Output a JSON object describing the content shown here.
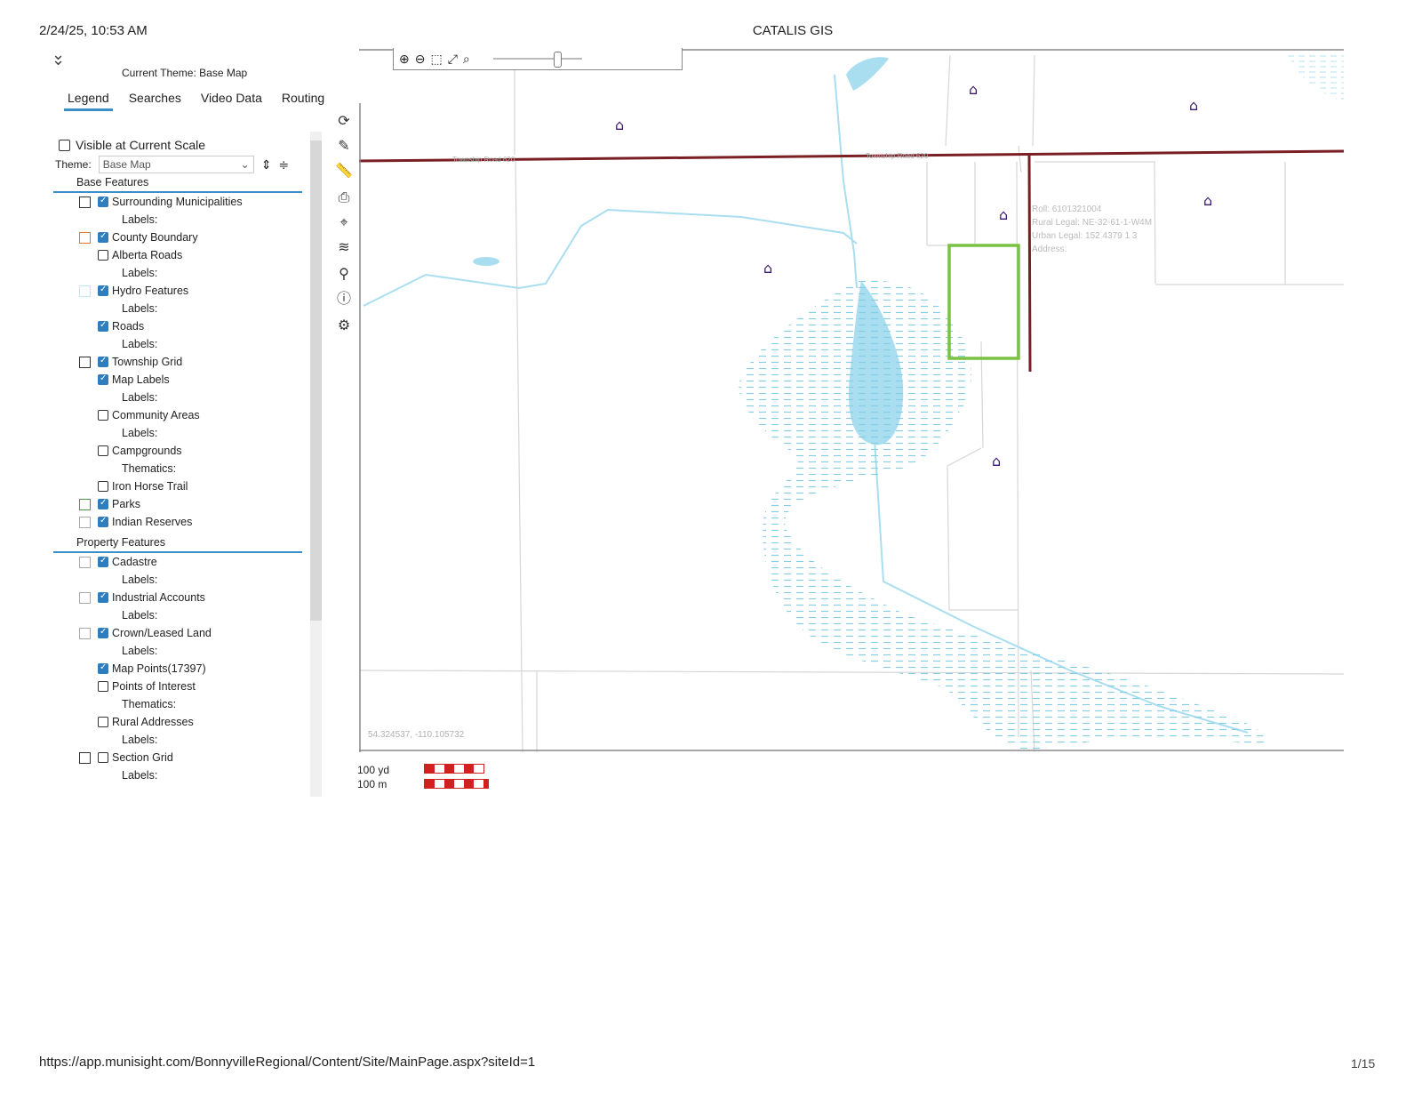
{
  "print_header": {
    "datetime": "2/24/25, 10:53 AM",
    "title": "CATALIS GIS"
  },
  "print_footer": {
    "url": "https://app.munisight.com/BonnyvilleRegional/Content/Site/MainPage.aspx?siteId=1",
    "page": "1/15"
  },
  "panel": {
    "current_theme_label": "Current Theme:",
    "current_theme_value": "Base Map",
    "tabs": [
      {
        "label": "Legend",
        "active": true
      },
      {
        "label": "Searches",
        "active": false
      },
      {
        "label": "Video Data",
        "active": false
      },
      {
        "label": "Routing",
        "active": false
      }
    ],
    "visible_at_scale": "Visible at Current Scale",
    "theme_label": "Theme:",
    "theme_value": "Base Map"
  },
  "legend": {
    "base_header": "Base Features",
    "base": [
      {
        "name": "Surrounding Municipalities",
        "checked": true,
        "swatch": "#333333",
        "sub": "Labels:"
      },
      {
        "name": "County Boundary",
        "checked": true,
        "swatch": "#e07a2e",
        "sub": ""
      },
      {
        "name": "Alberta Roads",
        "checked": false,
        "swatch": "",
        "sub": "Labels:"
      },
      {
        "name": "Hydro Features",
        "checked": true,
        "swatch": "#bfe7f5",
        "sub": "Labels:"
      },
      {
        "name": "Roads",
        "checked": true,
        "swatch": "",
        "sub": "Labels:"
      },
      {
        "name": "Township Grid",
        "checked": true,
        "swatch": "#333333",
        "sub": ""
      },
      {
        "name": "Map Labels",
        "checked": true,
        "swatch": "",
        "sub": "Labels:"
      },
      {
        "name": "Community Areas",
        "checked": false,
        "swatch": "",
        "sub": "Labels:"
      },
      {
        "name": "Campgrounds",
        "checked": false,
        "swatch": "",
        "sub": "Thematics:"
      },
      {
        "name": "Iron Horse Trail",
        "checked": false,
        "swatch": "",
        "sub": ""
      },
      {
        "name": "Parks",
        "checked": true,
        "swatch": "#4a9a4a",
        "sub": ""
      },
      {
        "name": "Indian Reserves",
        "checked": true,
        "swatch": "#aaaaaa",
        "sub": ""
      }
    ],
    "property_header": "Property Features",
    "property": [
      {
        "name": "Cadastre",
        "checked": true,
        "swatch": "#aaaaaa",
        "sub": "Labels:"
      },
      {
        "name": "Industrial Accounts",
        "checked": true,
        "swatch": "#aaaaaa",
        "sub": "Labels:"
      },
      {
        "name": "Crown/Leased Land",
        "checked": true,
        "swatch": "#aaaaaa",
        "sub": "Labels:"
      },
      {
        "name": "Map Points(17397)",
        "checked": true,
        "swatch": "",
        "sub": ""
      },
      {
        "name": "Points of Interest",
        "checked": false,
        "swatch": "",
        "sub": "Thematics:"
      },
      {
        "name": "Rural Addresses",
        "checked": false,
        "swatch": "",
        "sub": "Labels:"
      },
      {
        "name": "Section Grid",
        "checked": false,
        "swatch": "#333333",
        "sub": "Labels:"
      }
    ]
  },
  "map": {
    "road_label": "Township Road 620",
    "parcel_info": {
      "roll": "Roll: 6101321004",
      "rural_legal": "Rural Legal: NE-32-61-1-W4M",
      "urban_legal": "Urban Legal: 152 4379 1 3",
      "address": "Address:"
    },
    "coordinates": "54.324537, -110.105732",
    "colors": {
      "road": "#7a1f24",
      "water": "#a9def0",
      "parcel": "#7cc242",
      "house": "#3b1670"
    }
  },
  "scale": {
    "yd": "100 yd",
    "m": "100 m"
  }
}
